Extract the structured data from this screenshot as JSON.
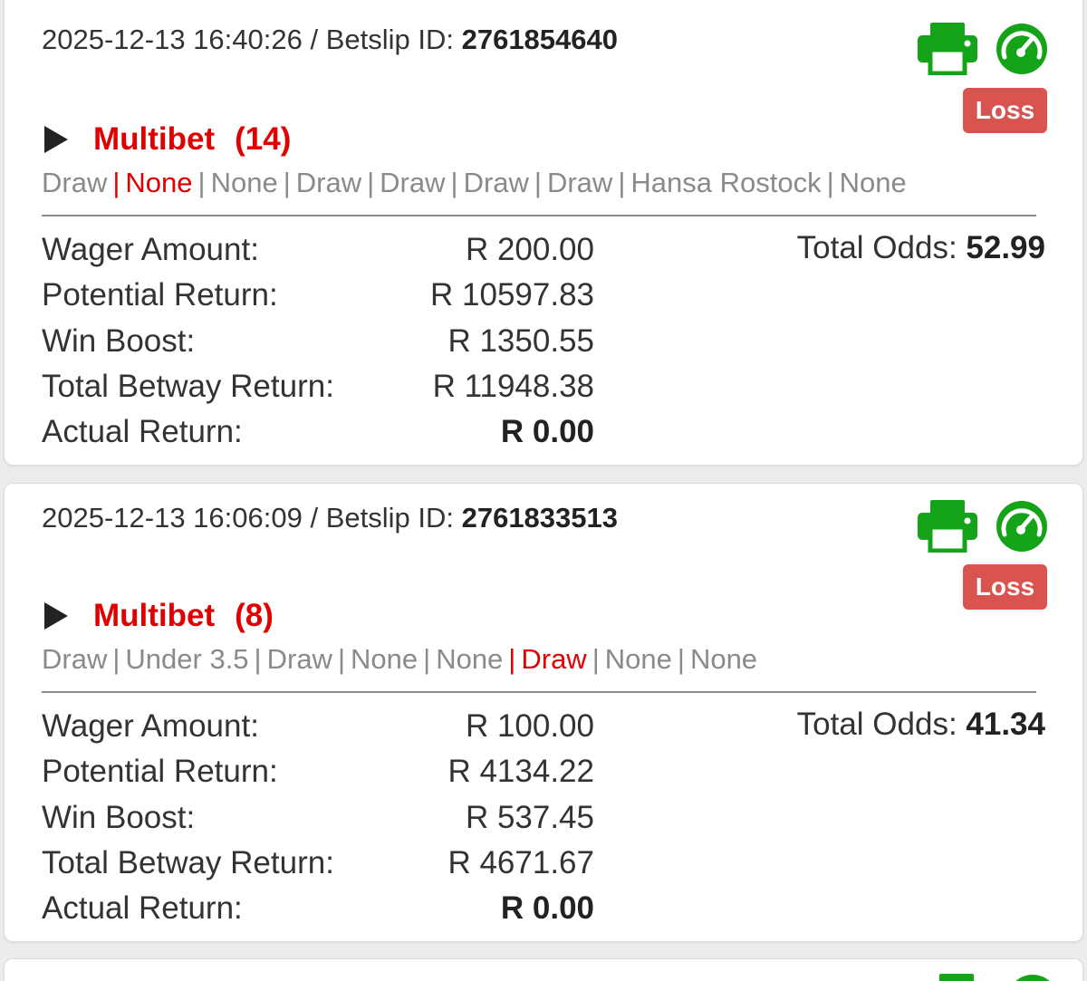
{
  "colors": {
    "loss_badge": "#d9534f",
    "bet_title": "#e00000",
    "icon_green": "#15a31a",
    "selection_text": "#8a8a8a"
  },
  "icons": {
    "print": "printer-icon",
    "gauge": "speedometer-icon",
    "expand": "play-triangle-icon"
  },
  "betslips": [
    {
      "datetime": "2025-12-13 16:40:26",
      "separator": " / ",
      "id_label": "Betslip ID: ",
      "id": "2761854640",
      "status": "Loss",
      "bet_type": "Multibet",
      "leg_count": "(14)",
      "selections": [
        {
          "text": "Draw",
          "highlight": false
        },
        {
          "text": "None",
          "highlight": true
        },
        {
          "text": "None",
          "highlight": false
        },
        {
          "text": "Draw",
          "highlight": false
        },
        {
          "text": "Draw",
          "highlight": false
        },
        {
          "text": "Draw",
          "highlight": false
        },
        {
          "text": "Draw",
          "highlight": false
        },
        {
          "text": "Hansa Rostock",
          "highlight": false
        },
        {
          "text": "None",
          "highlight": false
        }
      ],
      "wager_label": "Wager Amount:",
      "wager": "R 200.00",
      "potential_label": "Potential Return:",
      "potential": "R 10597.83",
      "boost_label": "Win Boost:",
      "boost": "R 1350.55",
      "total_label": "Total Betway Return:",
      "total": "R 11948.38",
      "actual_label": "Actual Return:",
      "actual": "R 0.00",
      "odds_label": "Total Odds: ",
      "odds": "52.99"
    },
    {
      "datetime": "2025-12-13 16:06:09",
      "separator": " / ",
      "id_label": "Betslip ID: ",
      "id": "2761833513",
      "status": "Loss",
      "bet_type": "Multibet",
      "leg_count": "(8)",
      "selections": [
        {
          "text": "Draw",
          "highlight": false
        },
        {
          "text": "Under 3.5",
          "highlight": false
        },
        {
          "text": "Draw",
          "highlight": false
        },
        {
          "text": "None",
          "highlight": false
        },
        {
          "text": "None",
          "highlight": false
        },
        {
          "text": "Draw",
          "highlight": true
        },
        {
          "text": "None",
          "highlight": false
        },
        {
          "text": "None",
          "highlight": false
        }
      ],
      "wager_label": "Wager Amount:",
      "wager": "R 100.00",
      "potential_label": "Potential Return:",
      "potential": "R 4134.22",
      "boost_label": "Win Boost:",
      "boost": "R 537.45",
      "total_label": "Total Betway Return:",
      "total": "R 4671.67",
      "actual_label": "Actual Return:",
      "actual": "R 0.00",
      "odds_label": "Total Odds: ",
      "odds": "41.34"
    }
  ]
}
